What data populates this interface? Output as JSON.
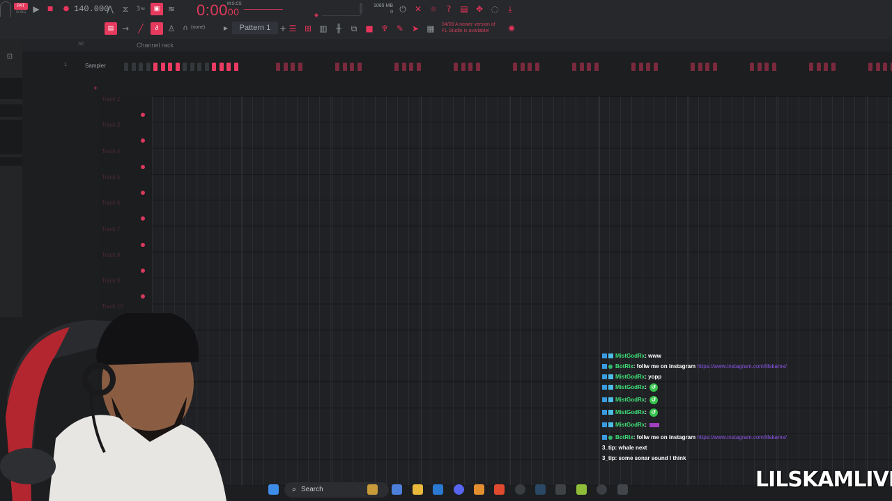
{
  "toolbar": {
    "tempo": "140.000",
    "time_main": "0:00",
    "time_frac": "00",
    "time_unit": "M:S:CS",
    "memory": "1065 MB",
    "cpu_value": "0",
    "pattern": "Pattern 1",
    "snap": "(none)",
    "news": [
      "04/09  A newer version of",
      "FL Studio is available!"
    ]
  },
  "channel_rack": {
    "title": "Channel rack",
    "filter": "All",
    "channel_number": "1",
    "channel_name": "Sampler"
  },
  "playlist": {
    "tracks": [
      "Track 2",
      "Track 3",
      "Track 4",
      "Track 5",
      "Track 6",
      "Track 7",
      "Track 8",
      "Track 9",
      "Track 10"
    ]
  },
  "chat": [
    {
      "user": "MistGodRx",
      "user_color": "blue",
      "text": ": www",
      "link": "",
      "emote": ""
    },
    {
      "user": "BotRix",
      "user_color": "green",
      "text": ": follw me on instagram",
      "link": "https://www.instagram.com/lilskamx/",
      "emote": ""
    },
    {
      "user": "MistGodRx",
      "user_color": "blue",
      "text": ": yopp",
      "link": "",
      "emote": ""
    },
    {
      "user": "MistGodRx",
      "user_color": "blue",
      "text": ":",
      "link": "",
      "emote": "green"
    },
    {
      "user": "MistGodRx",
      "user_color": "blue",
      "text": ":",
      "link": "",
      "emote": "green"
    },
    {
      "user": "MistGodRx",
      "user_color": "blue",
      "text": ":",
      "link": "",
      "emote": "green"
    },
    {
      "user": "MistGodRx",
      "user_color": "blue",
      "text": ":",
      "link": "",
      "emote": "purple"
    },
    {
      "user": "BotRix",
      "user_color": "green",
      "text": ": follw me on instagram",
      "link": "https://www.instagram.com/lilskamx/",
      "emote": ""
    },
    {
      "user": "3_tip",
      "user_color": "plain",
      "text": ": whale next",
      "link": "",
      "emote": ""
    },
    {
      "user": "3_tip",
      "user_color": "plain",
      "text": ": some sonar sound I think",
      "link": "",
      "emote": ""
    }
  ],
  "taskbar": {
    "search_label": "Search"
  },
  "watermark": "LILSKAMLIVE",
  "colors": {
    "accent": "#e8345b",
    "background": "#1d1e20",
    "chat_green": "#3fe07a",
    "chat_link": "#8a56e8"
  }
}
